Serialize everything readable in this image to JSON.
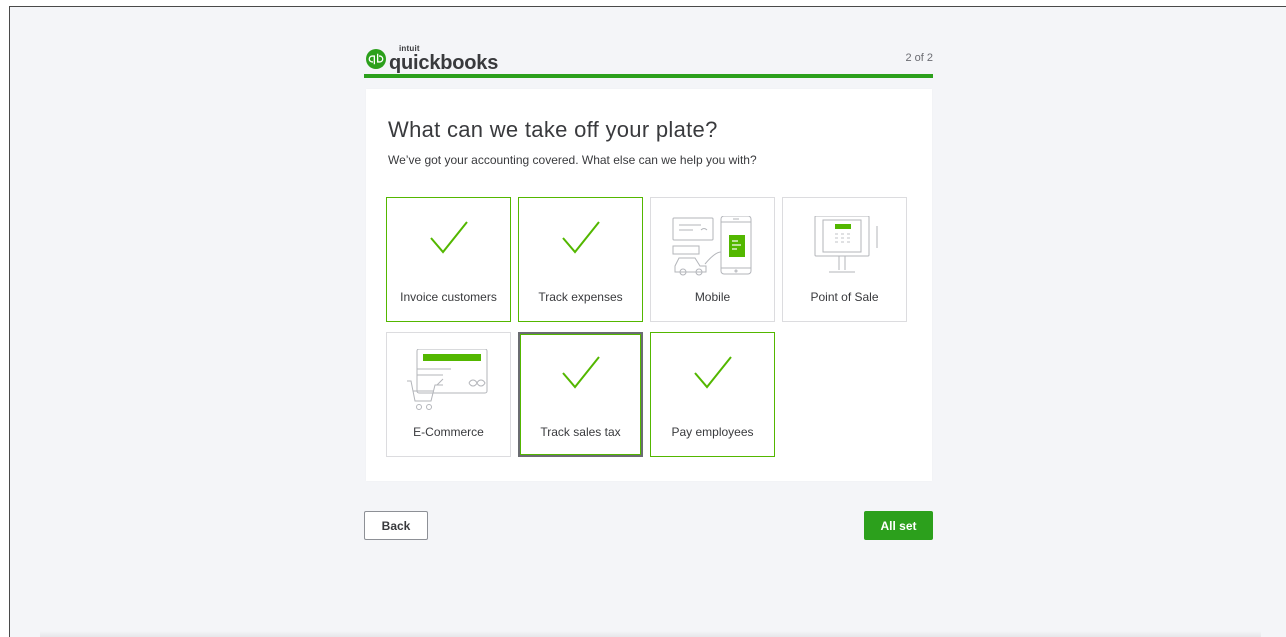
{
  "brand": {
    "parent": "intuit",
    "name": "quickbooks",
    "logo_badge_text": "qb",
    "color": "#2ca01c"
  },
  "header": {
    "step_text": "2 of 2"
  },
  "progress": {
    "fraction": 1.0
  },
  "card": {
    "title": "What can we take off your plate?",
    "subtitle": "We’ve got your accounting covered. What else can we help you with?"
  },
  "options": [
    {
      "label": "Invoice customers",
      "icon": "check-icon",
      "selected": true
    },
    {
      "label": "Track expenses",
      "icon": "check-icon",
      "selected": true
    },
    {
      "label": "Mobile",
      "icon": "mobile-illustration-icon",
      "selected": false
    },
    {
      "label": "Point of Sale",
      "icon": "point-of-sale-illustration-icon",
      "selected": false
    },
    {
      "label": "E-Commerce",
      "icon": "ecommerce-illustration-icon",
      "selected": false
    },
    {
      "label": "Track sales tax",
      "icon": "check-icon",
      "selected": true,
      "focused": true
    },
    {
      "label": "Pay employees",
      "icon": "check-icon",
      "selected": true
    }
  ],
  "buttons": {
    "back_label": "Back",
    "submit_label": "All set"
  },
  "colors": {
    "accent_green": "#2ca01c",
    "selected_border": "#53b700",
    "background": "#f4f5f8",
    "text": "#393a3d"
  }
}
